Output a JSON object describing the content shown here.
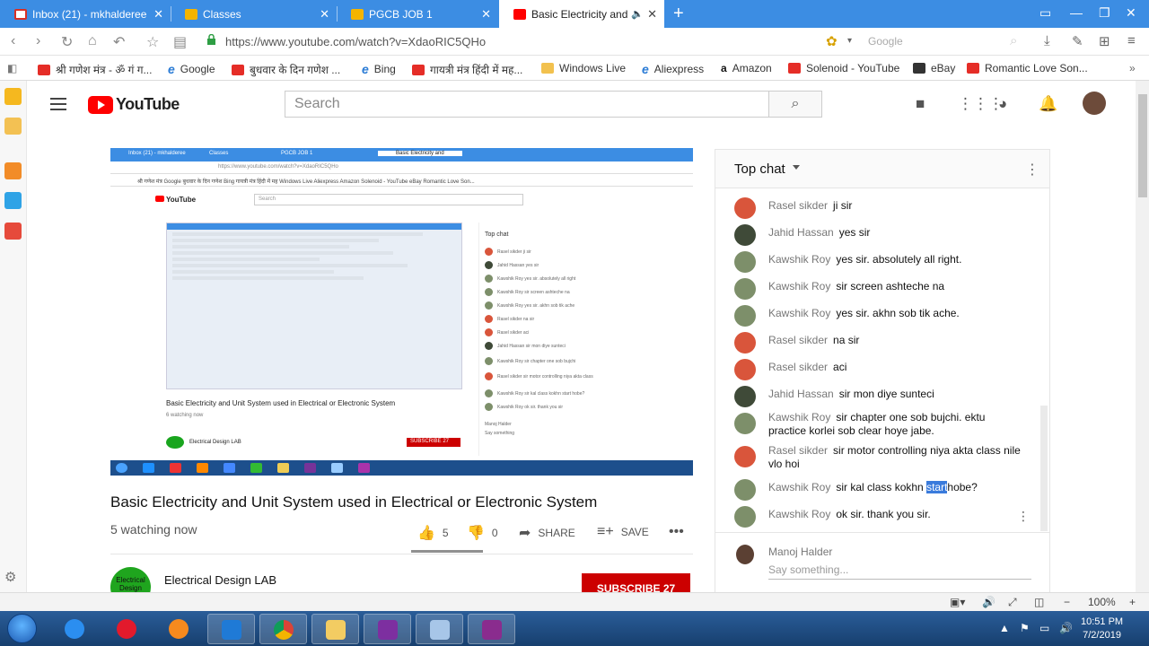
{
  "browser": {
    "tabs": [
      {
        "label": "Inbox (21) - mkhalderee",
        "icon": "gmail-icon"
      },
      {
        "label": "Classes",
        "icon": "classroom-icon"
      },
      {
        "label": "PGCB JOB 1",
        "icon": "classroom-icon"
      },
      {
        "label": "Basic Electricity and",
        "icon": "youtube-icon",
        "active": true
      }
    ],
    "url": "https://www.youtube.com/watch?v=XdaoRIC5QHo",
    "search_placeholder": "Google",
    "bookmarks": [
      "श्री गणेश मंत्र - ॐ गं ग...",
      "Google",
      "बुधवार के दिन गणेश ...",
      "Bing",
      "गायत्री मंत्र हिंदी में मह...",
      "Windows Live",
      "Aliexpress",
      "Amazon",
      "Solenoid - YouTube",
      "eBay",
      "Romantic Love Son..."
    ]
  },
  "youtube": {
    "logo_text": "YouTube",
    "search_placeholder": "Search"
  },
  "video": {
    "title": "Basic Electricity and Unit System used in Electrical or Electronic System",
    "watching": "5 watching now",
    "likes": "5",
    "dislikes": "0",
    "like_ratio": 1.0,
    "share_label": "SHARE",
    "save_label": "SAVE",
    "channel_name": "Electrical Design LAB",
    "channel_avatar_text": "Electrical Design",
    "subscribe_label": "SUBSCRIBE  27"
  },
  "chat": {
    "title": "Top chat",
    "messages": [
      {
        "author": "Rasel sikder",
        "text": "ji sir",
        "avatar": "red"
      },
      {
        "author": "Jahid Hassan",
        "text": "yes sir",
        "avatar": "face"
      },
      {
        "author": "Kawshik Roy",
        "text": "yes sir. absolutely all right.",
        "avatar": "group"
      },
      {
        "author": "Kawshik Roy",
        "text": "sir screen ashteche na",
        "avatar": "group"
      },
      {
        "author": "Kawshik Roy",
        "text": "yes sir. akhn sob tik ache.",
        "avatar": "group"
      },
      {
        "author": "Rasel sikder",
        "text": "na sir",
        "avatar": "red"
      },
      {
        "author": "Rasel sikder",
        "text": "aci",
        "avatar": "red"
      },
      {
        "author": "Jahid Hassan",
        "text": "sir mon diye sunteci",
        "avatar": "face"
      },
      {
        "author": "Kawshik Roy",
        "text": "sir chapter one sob bujchi. ektu practice korlei sob clear hoye jabe.",
        "avatar": "group"
      },
      {
        "author": "Rasel sikder",
        "text": "sir motor controlling niya akta class nile vlo hoi",
        "avatar": "red"
      },
      {
        "author": "Kawshik Roy",
        "text_before": "sir kal class kokhn ",
        "highlight": "start",
        "text_after": "hobe?",
        "avatar": "group"
      },
      {
        "author": "Kawshik Roy",
        "text": "ok sir. thank you sir.",
        "avatar": "group"
      }
    ],
    "input_user": "Manoj Halder",
    "input_placeholder": "Say something..."
  },
  "inner_video": {
    "tabs": [
      "Inbox (21) - mkhalderee",
      "Classes",
      "PGCB JOB 1",
      "Basic Electricity and"
    ],
    "url": "https://www.youtube.com/watch?v=XdaoRIC5QHo",
    "bookmarks": "श्री गणेश मंत्र    Google    बुधवार के दिन गणेश    Bing    गायत्री मंत्र हिंदी में मह    Windows Live    Aliexpress    Amazon    Solenoid - YouTube    eBay    Romantic Love Son...",
    "logo_text": "YouTube",
    "search": "Search",
    "caption": "Basic Electricity and Unit System used in Electrical or Electronic System",
    "watching": "6 watching now",
    "channel": "Electrical Design LAB",
    "subscribe": "SUBSCRIBE 27",
    "chat_title": "Top chat",
    "chat_rows": [
      "Rasel sikder  ji sir",
      "Jahid Hassan  yes sir",
      "Kawshik Roy  yes sir. absolutely all right",
      "Kawshik Roy  sir screen ashteche na",
      "Kawshik Roy  yes sir. akhn sob tik ache",
      "Rasel sikder  na sir",
      "Rasel sikder  aci",
      "Jahid Hassan  sir mon diye sunteci",
      "Kawshik Roy  sir chapter one sob bujchi",
      "Rasel sikder  sir motor controlling niya akta class",
      "Kawshik Roy  sir kal class kokhn start hobe?",
      "Kawshik Roy  ok sir. thank you sir"
    ],
    "input_user": "Manoj Halder",
    "input_placeholder": "Say something"
  },
  "statusbar": {
    "zoom": "100%"
  },
  "taskbar": {
    "time": "10:51 PM",
    "date": "7/2/2019"
  },
  "colors": {
    "tab_bar": "#3c8de3",
    "youtube_red": "#ff0000",
    "subscribe_red": "#cc0000",
    "highlight": "#3a7bdc"
  }
}
